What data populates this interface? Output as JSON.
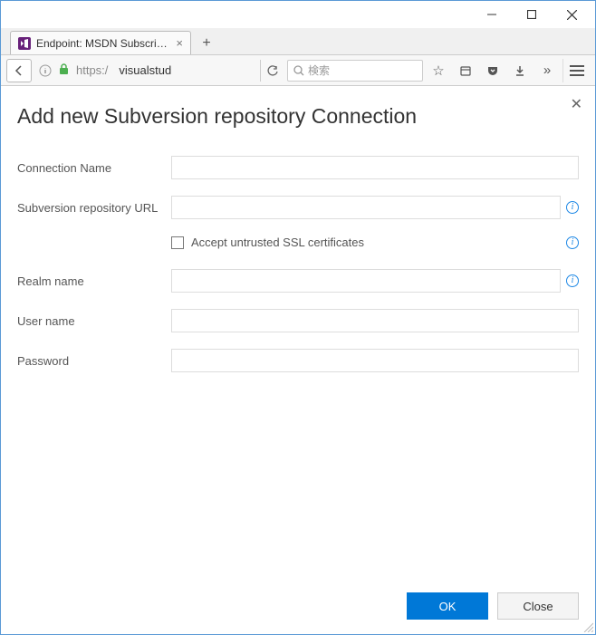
{
  "window": {
    "tab_title": "Endpoint: MSDN Subscrip...",
    "url_scheme": "https:/",
    "url_host": "visualstud",
    "search_placeholder": "検索"
  },
  "dialog": {
    "title": "Add new Subversion repository Connection",
    "labels": {
      "connection_name": "Connection Name",
      "repo_url": "Subversion repository URL",
      "accept_ssl": "Accept untrusted SSL certificates",
      "realm": "Realm name",
      "user": "User name",
      "password": "Password"
    },
    "values": {
      "connection_name": "",
      "repo_url": "",
      "accept_ssl_checked": false,
      "realm": "",
      "user": "",
      "password": ""
    },
    "buttons": {
      "ok": "OK",
      "close": "Close"
    }
  }
}
